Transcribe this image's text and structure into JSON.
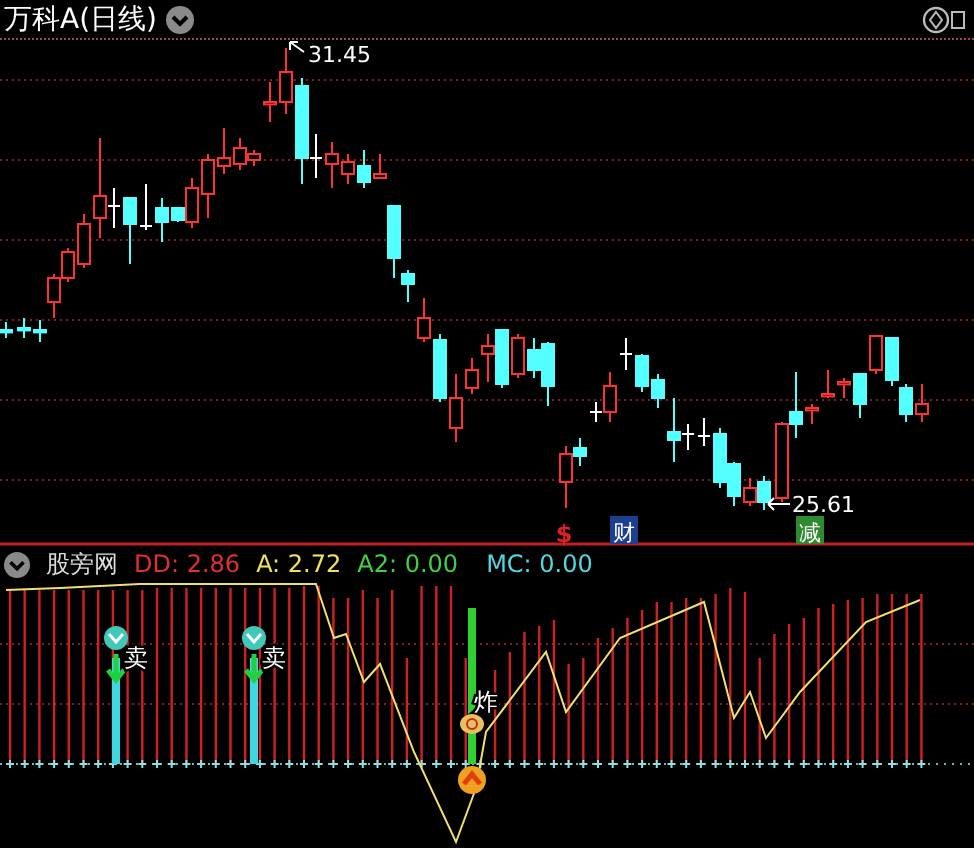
{
  "chart": {
    "title": "万科A(日线)",
    "high_label": "31.45",
    "low_label": "25.61",
    "event_markers": [
      {
        "label": "$",
        "color": "#e02020"
      },
      {
        "label": "财",
        "color": "#1c3f8f"
      },
      {
        "label": "减",
        "color": "#2f8a2f"
      }
    ]
  },
  "indicator": {
    "name": "股旁网",
    "values": [
      {
        "label": "DD: 2.86",
        "color": "#e03030"
      },
      {
        "label": "A: 2.72",
        "color": "#f0e060"
      },
      {
        "label": "A2: 0.00",
        "color": "#40d040"
      },
      {
        "label": "MC: 0.00",
        "color": "#50d8e0"
      }
    ],
    "signals": [
      {
        "label": "卖",
        "kind": "sell"
      },
      {
        "label": "卖",
        "kind": "sell"
      },
      {
        "label": "炸",
        "kind": "buy"
      }
    ]
  }
}
